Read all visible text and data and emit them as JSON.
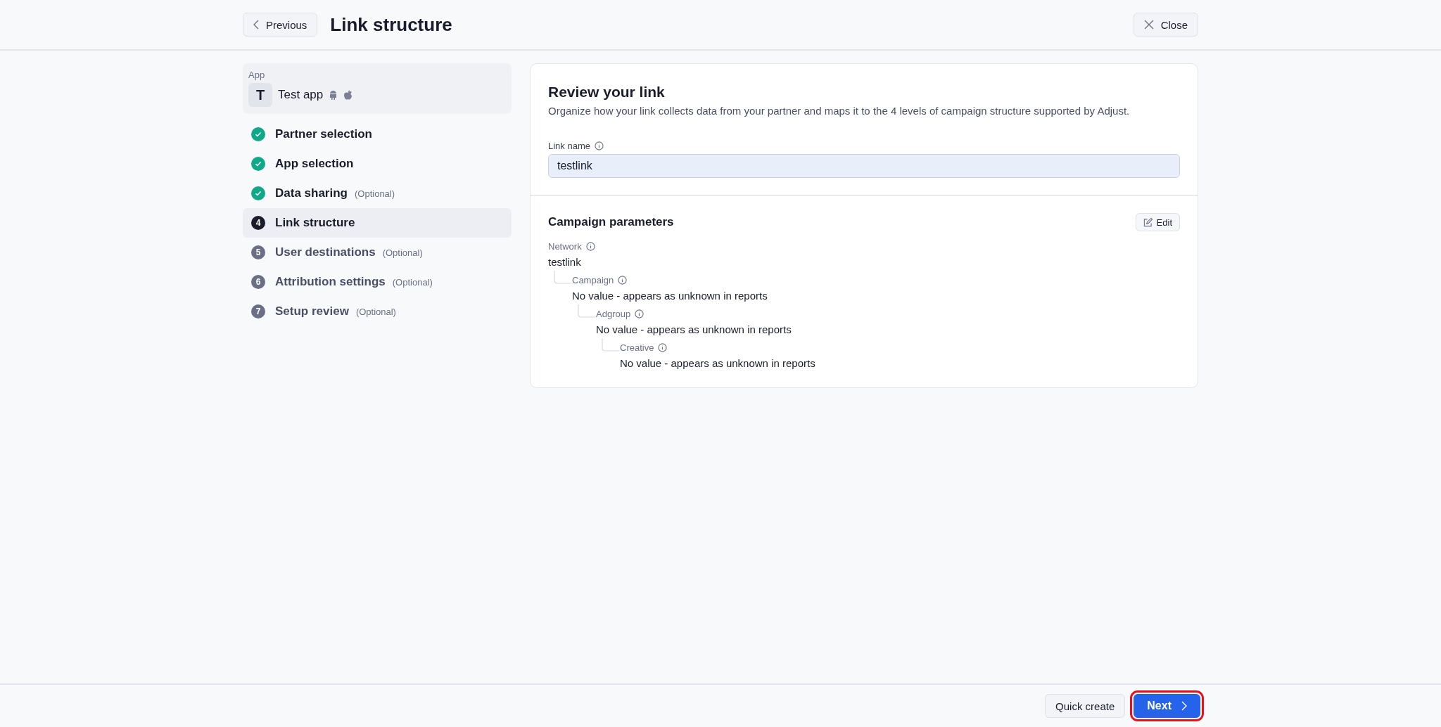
{
  "header": {
    "back_button": "Previous",
    "title": "Link structure",
    "close_button": "Close"
  },
  "sidebar": {
    "app": {
      "label": "App",
      "initial": "T",
      "name": "Test app"
    },
    "steps": [
      {
        "label": "Partner selection",
        "kind": "done",
        "selected": false
      },
      {
        "label": "App selection",
        "kind": "done",
        "selected": false
      },
      {
        "label": "Data sharing",
        "note": "(Optional)",
        "kind": "done",
        "selected": false
      },
      {
        "number": "4",
        "label": "Link structure",
        "kind": "pending",
        "selected": true
      },
      {
        "number": "5",
        "label": "User destinations",
        "note": "(Optional)",
        "kind": "pending",
        "selected": false
      },
      {
        "number": "6",
        "label": "Attribution settings",
        "note": "(Optional)",
        "kind": "pending",
        "selected": false
      },
      {
        "number": "7",
        "label": "Setup review",
        "note": "(Optional)",
        "kind": "pending",
        "selected": false
      }
    ]
  },
  "card": {
    "title": "Review your link",
    "description": "Organize how your link collects data from your partner and maps it to the 4 levels of campaign structure supported by Adjust.",
    "link_name": {
      "label": "Link name",
      "value": "testlink"
    },
    "campaign_parameters": {
      "title": "Campaign parameters",
      "edit_button": "Edit",
      "tree": [
        {
          "label": "Network",
          "value": "testlink",
          "children": [
            {
              "label": "Campaign",
              "value": "No value - appears as unknown in reports",
              "children": [
                {
                  "label": "Adgroup",
                  "value": "No value - appears as unknown in reports",
                  "children": [
                    {
                      "label": "Creative",
                      "value": "No value - appears as unknown in reports"
                    }
                  ]
                }
              ]
            }
          ]
        }
      ]
    }
  },
  "footer": {
    "quick_create_button": "Quick create",
    "next_button": {
      "label": "Next",
      "highlighted": true
    }
  }
}
